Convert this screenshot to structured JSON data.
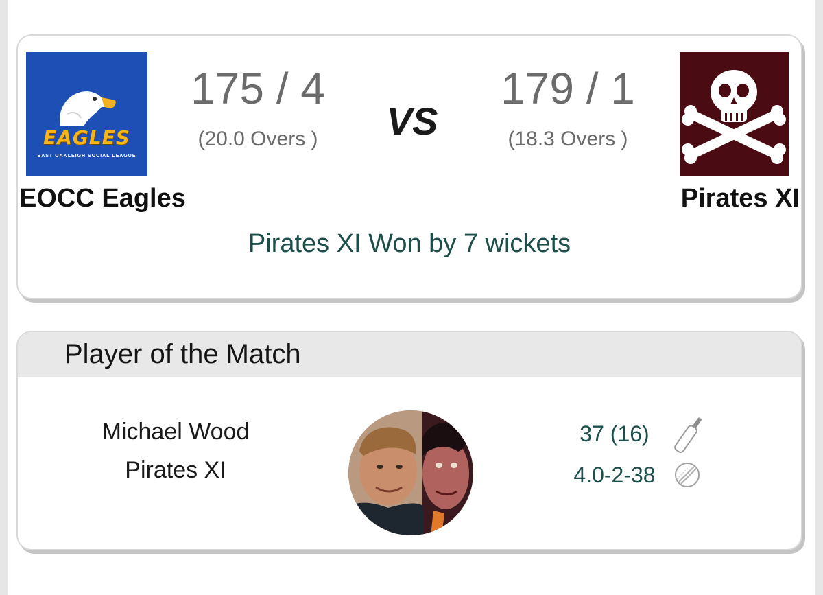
{
  "match": {
    "home": {
      "name": "EOCC Eagles",
      "score": "175 / 4",
      "overs": "(20.0 Overs )",
      "logo_text": "EAGLES",
      "logo_subtext": "EAST OAKLEIGH SOCIAL LEAGUE",
      "logo_color": "#1e4fb4"
    },
    "away": {
      "name": "Pirates XI",
      "score": "179 / 1",
      "overs": "(18.3 Overs )",
      "logo_color": "#4a0c12"
    },
    "vs_label": "VS",
    "result": "Pirates XI Won by 7 wickets"
  },
  "player_of_match": {
    "title": "Player of the Match",
    "name": "Michael Wood",
    "team": "Pirates XI",
    "batting": "37 (16)",
    "bowling": "4.0-2-38",
    "batting_icon": "cricket-bat-icon",
    "bowling_icon": "cricket-ball-icon"
  },
  "colors": {
    "accent_teal": "#1d4f4a",
    "score_gray": "#6b6b6b"
  }
}
